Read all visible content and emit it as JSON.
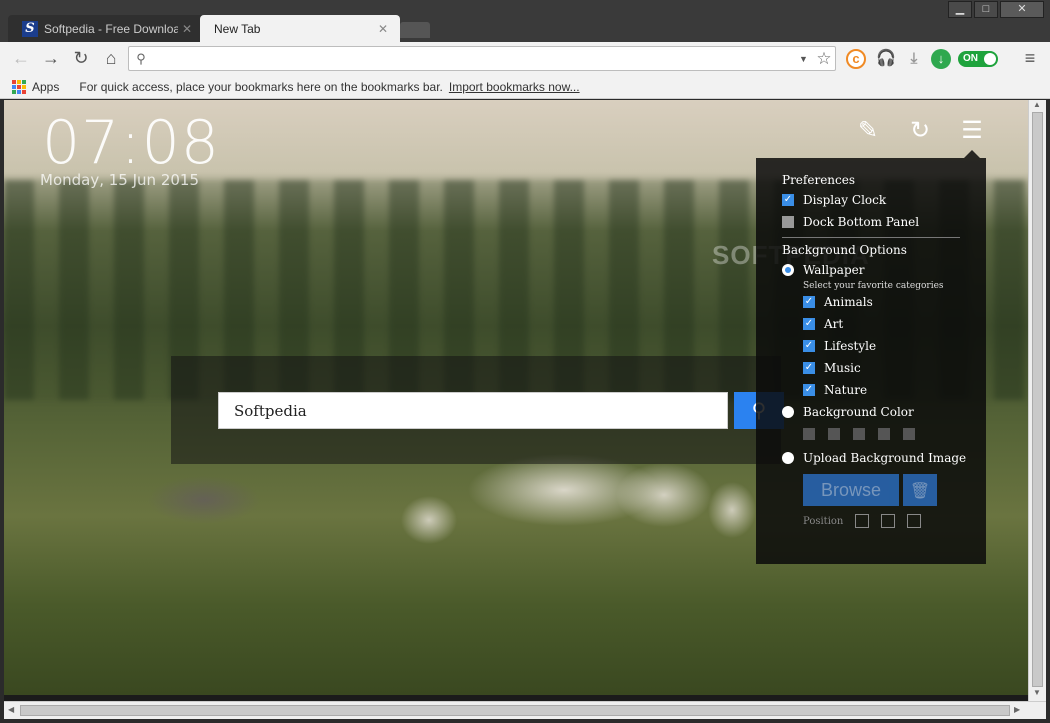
{
  "window": {
    "minimize": "▁",
    "maximize": "□",
    "close": "✕"
  },
  "tabs": [
    {
      "title": "Softpedia - Free Downloa",
      "favicon": "S"
    },
    {
      "title": "New Tab"
    }
  ],
  "toolbar": {
    "omnibox_value": "",
    "extensions_toggle": "ON"
  },
  "bookmarks": {
    "apps_label": "Apps",
    "message": "For quick access, place your bookmarks here on the bookmarks bar.",
    "import_link": "Import bookmarks now..."
  },
  "newtab": {
    "clock": "07:08",
    "date": "Monday, 15 Jun 2015",
    "watermark": "SOFTPEDIA",
    "search_value": "Softpedia"
  },
  "settings": {
    "preferences_title": "Preferences",
    "display_clock": {
      "label": "Display Clock",
      "checked": true
    },
    "dock_bottom": {
      "label": "Dock Bottom Panel",
      "checked": false
    },
    "background_title": "Background Options",
    "wallpaper": {
      "label": "Wallpaper",
      "selected": true
    },
    "categories_hint": "Select your favorite categories",
    "categories": [
      {
        "label": "Animals",
        "checked": true
      },
      {
        "label": "Art",
        "checked": true
      },
      {
        "label": "Lifestyle",
        "checked": true
      },
      {
        "label": "Music",
        "checked": true
      },
      {
        "label": "Nature",
        "checked": true
      }
    ],
    "bg_color": {
      "label": "Background Color",
      "selected": false
    },
    "upload": {
      "label": "Upload Background Image",
      "selected": false
    },
    "browse_label": "Browse",
    "position_label": "Position"
  },
  "colors": {
    "accent": "#2b82f0",
    "panel_bg": "#0a0a0a"
  }
}
